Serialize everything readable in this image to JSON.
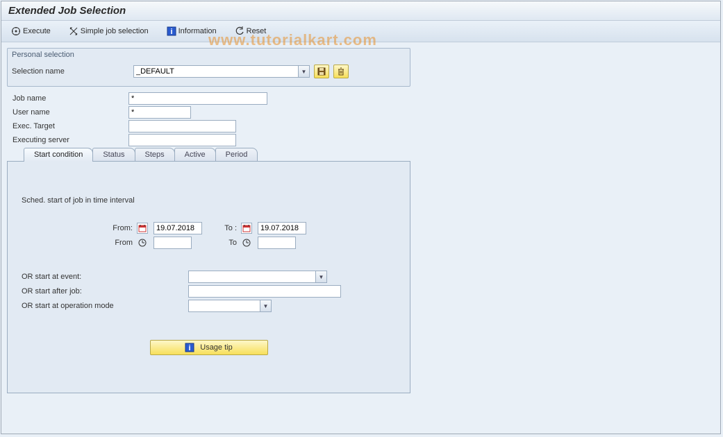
{
  "title": "Extended Job Selection",
  "watermark": "www.tutorialkart.com",
  "toolbar": {
    "execute": "Execute",
    "simple": "Simple job selection",
    "info": "Information",
    "reset": "Reset"
  },
  "personal": {
    "panel_title": "Personal selection",
    "selection_name_label": "Selection name",
    "selection_name_value": "_DEFAULT"
  },
  "fields": {
    "job_name_label": "Job name",
    "job_name_value": "*",
    "user_name_label": "User name",
    "user_name_value": "*",
    "exec_target_label": "Exec. Target",
    "exec_target_value": "",
    "exec_server_label": "Executing server",
    "exec_server_value": ""
  },
  "tabs": {
    "start": "Start condition",
    "status": "Status",
    "steps": "Steps",
    "active": "Active",
    "period": "Period"
  },
  "start_cond": {
    "heading": "Sched. start of job in time interval",
    "from_label": "From:",
    "to_label": "To :",
    "from2_label": "From",
    "to2_label": "To",
    "date_from": "19.07.2018",
    "date_to": "19.07.2018",
    "time_from": "",
    "time_to": "",
    "or_event_label": "OR start at event:",
    "or_event_value": "",
    "or_after_job_label": "OR start after job:",
    "or_after_job_value": "",
    "or_opmode_label": "OR start at operation mode",
    "or_opmode_value": "",
    "usage_tip": "Usage tip"
  }
}
